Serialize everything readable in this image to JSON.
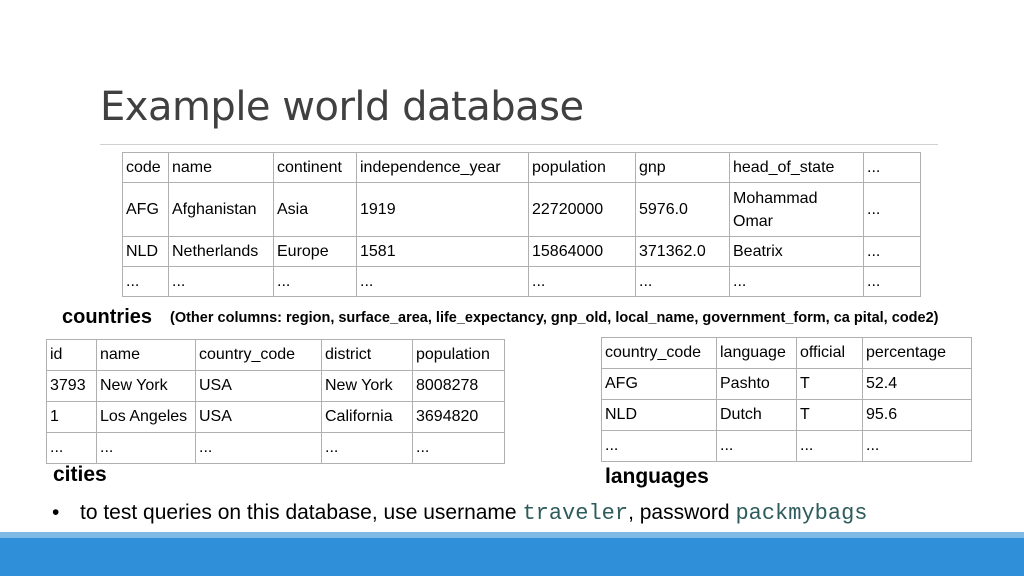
{
  "title": "Example world database",
  "countries_table": {
    "columns": [
      "code",
      "name",
      "continent",
      "independence_year",
      "population",
      "gnp",
      "head_of_state",
      "..."
    ],
    "rows": [
      [
        "AFG",
        "Afghanistan",
        "Asia",
        "1919",
        "22720000",
        "5976.0",
        "Mohammad Omar",
        "..."
      ],
      [
        "NLD",
        "Netherlands",
        "Europe",
        "1581",
        "15864000",
        "371362.0",
        "Beatrix",
        "..."
      ],
      [
        "...",
        "...",
        "...",
        "...",
        "...",
        "...",
        "...",
        "..."
      ]
    ]
  },
  "countries_caption": "countries",
  "countries_other": "(Other columns: region, surface_area, life_expectancy, gnp_old, local_name, government_form, ca pital, code2)",
  "cities_table": {
    "columns": [
      "id",
      "name",
      "country_code",
      "district",
      "population"
    ],
    "rows": [
      [
        "3793",
        "New York",
        "USA",
        "New York",
        "8008278"
      ],
      [
        "1",
        "Los Angeles",
        "USA",
        "California",
        "3694820"
      ],
      [
        "...",
        "...",
        "...",
        "...",
        "..."
      ]
    ]
  },
  "cities_caption": "cities",
  "languages_table": {
    "columns": [
      "country_code",
      "language",
      "official",
      "percentage"
    ],
    "rows": [
      [
        "AFG",
        "Pashto",
        "T",
        "52.4"
      ],
      [
        "NLD",
        "Dutch",
        "T",
        "95.6"
      ],
      [
        "...",
        "...",
        "...",
        "..."
      ]
    ]
  },
  "languages_caption": "languages",
  "bullet": {
    "marker": "•",
    "prefix": "to test queries on this database, use username ",
    "username": "traveler",
    "middle": ", password ",
    "password": "packmybags"
  },
  "colors": {
    "title": "#404040",
    "footer": "#2f8fd8",
    "footer_light": "#7fb9e6",
    "mono_text": "#2e5b5b"
  }
}
